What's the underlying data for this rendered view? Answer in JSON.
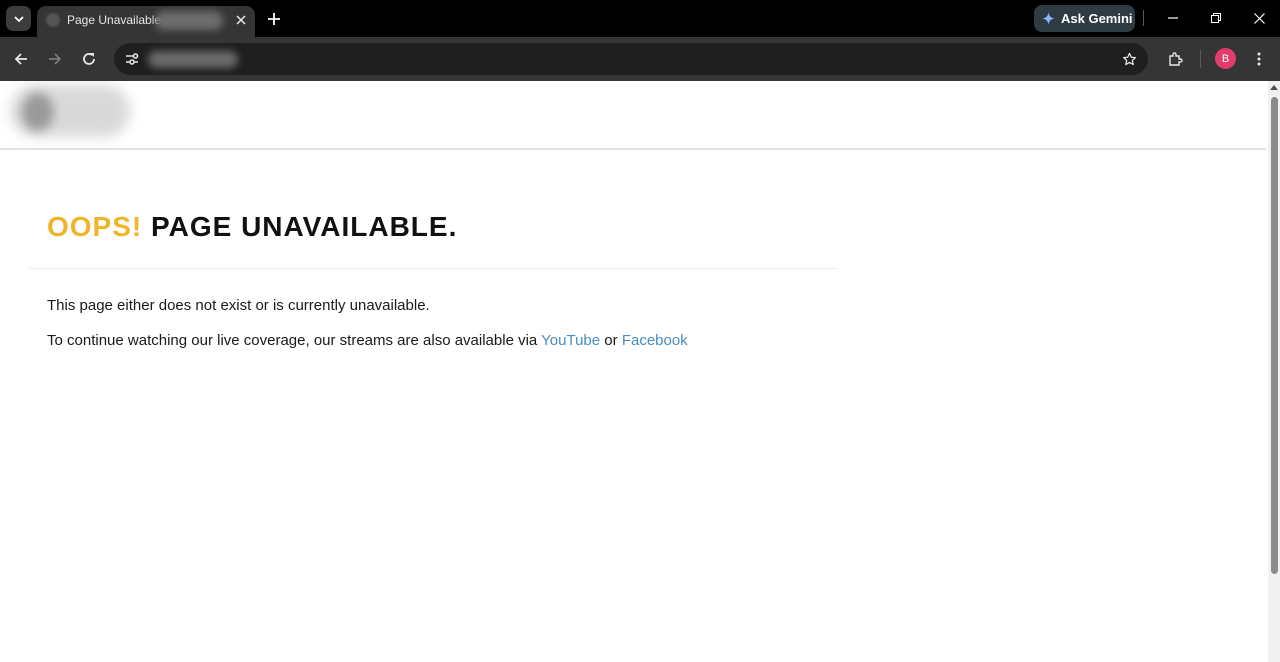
{
  "tab": {
    "title": "Page Unavailable",
    "close_icon": "close-icon"
  },
  "toolbar": {
    "gemini_label": "Ask Gemini",
    "profile_initial": "B"
  },
  "page": {
    "heading_accent": "OOPS!",
    "heading_rest": "PAGE UNAVAILABLE.",
    "line1": "This page either does not exist or is currently unavailable.",
    "line2_prefix": "To continue watching our live coverage, our streams are also available via ",
    "link_youtube": "YouTube",
    "line2_middle": " or ",
    "link_facebook": "Facebook"
  },
  "colors": {
    "accent": "#f0b52a",
    "link": "#4a8cc2",
    "profile": "#e23c6d"
  }
}
